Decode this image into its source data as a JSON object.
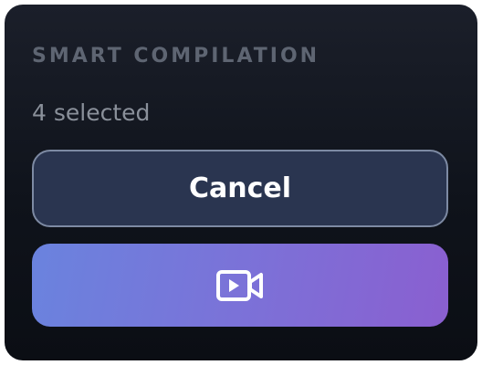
{
  "panel": {
    "title": "SMART COMPILATION",
    "selection_text": "4 selected",
    "cancel_label": "Cancel",
    "create_icon": "video-camera-icon",
    "colors": {
      "background": "#0f131b",
      "cancel_fill": "#2a3550",
      "cancel_border": "#7d8aa3",
      "gradient_start": "#6a83de",
      "gradient_end": "#8a5fd0"
    }
  }
}
